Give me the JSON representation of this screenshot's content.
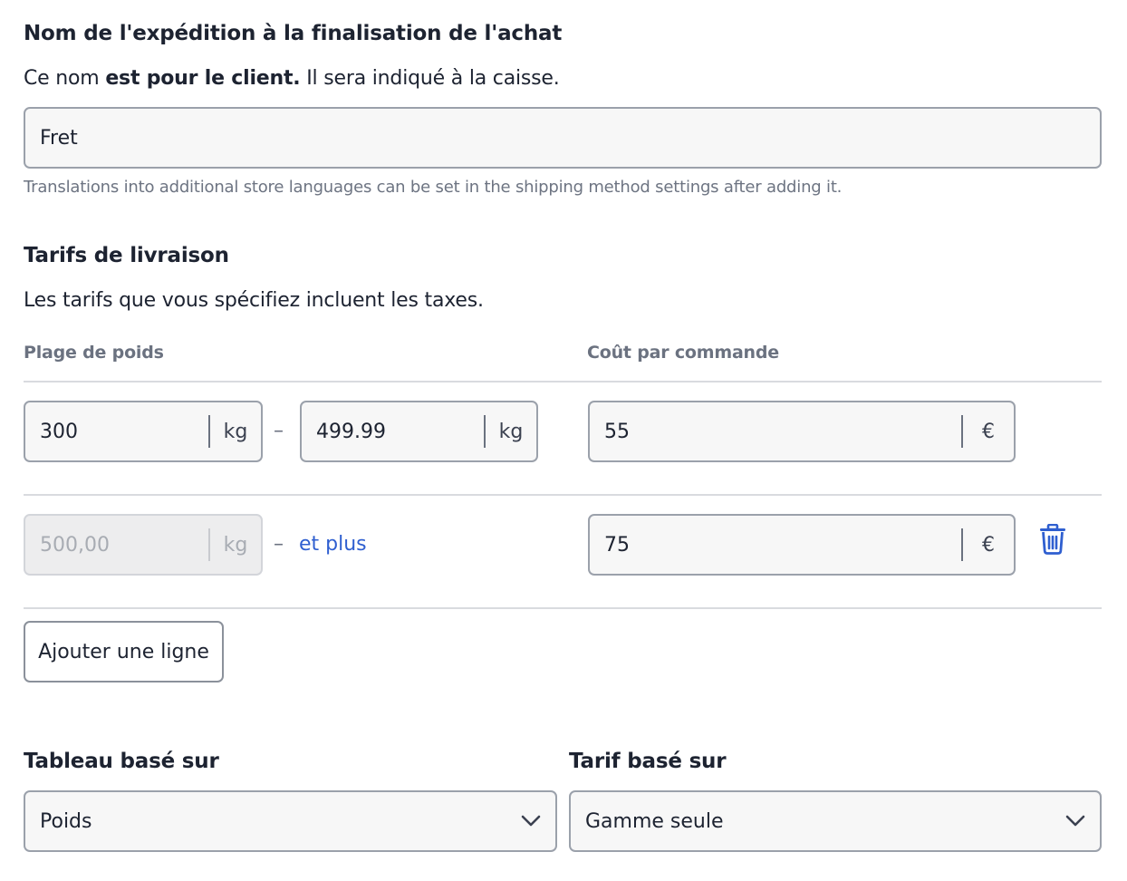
{
  "checkout_name": {
    "title": "Nom de l'expédition à la finalisation de l'achat",
    "description_prefix": "Ce nom ",
    "description_bold": "est pour le client.",
    "description_suffix": " Il sera indiqué à la caisse.",
    "value": "Fret",
    "hint": "Translations into additional store languages can be set in the shipping method settings after adding it."
  },
  "rates": {
    "title": "Tarifs de livraison",
    "description": "Les tarifs que vous spécifiez incluent les taxes.",
    "col_weight": "Plage de poids",
    "col_cost": "Coût par commande",
    "separator": "–",
    "rows": [
      {
        "from": "300",
        "from_unit": "kg",
        "to": "499.99",
        "to_unit": "kg",
        "cost": "55",
        "currency": "€"
      },
      {
        "from": "500,00",
        "from_unit": "kg",
        "to_text": "et plus",
        "cost": "75",
        "currency": "€",
        "delete_icon": "trash-icon"
      }
    ],
    "add_row_label": "Ajouter une ligne"
  },
  "table_based": {
    "label": "Tableau basé sur",
    "value": "Poids"
  },
  "rate_based": {
    "label": "Tarif basé sur",
    "value": "Gamme seule"
  },
  "colors": {
    "accent": "#2f5fd0",
    "text": "#1d2331",
    "muted": "#6b7280"
  }
}
